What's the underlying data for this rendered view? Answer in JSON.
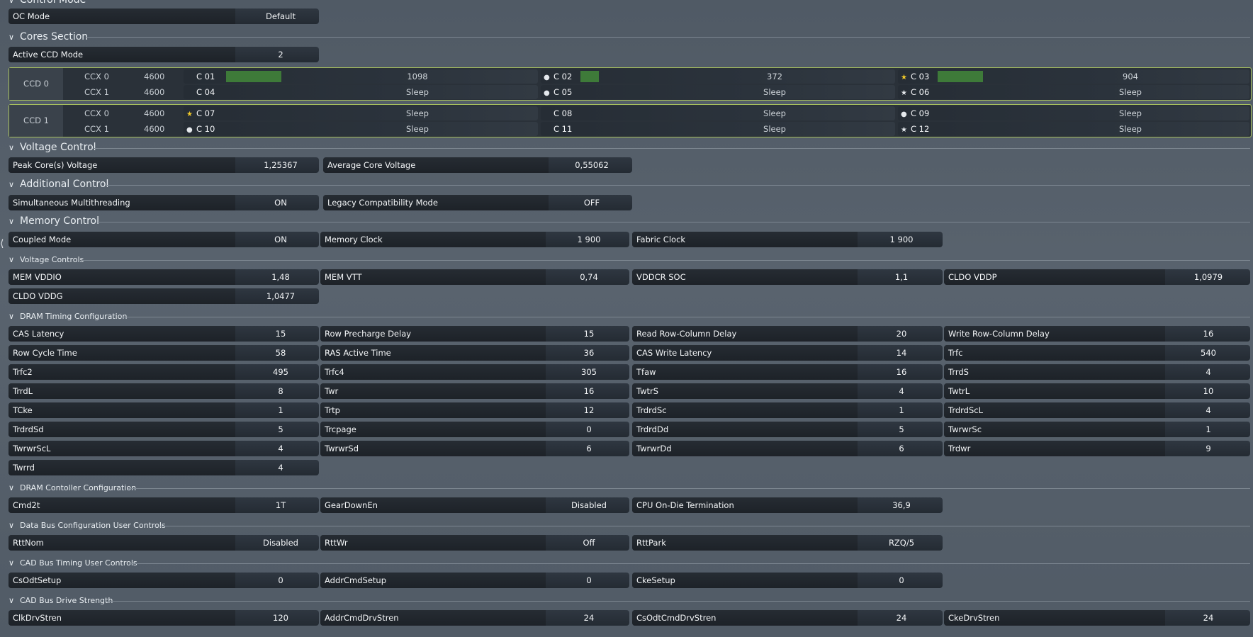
{
  "sections": {
    "control_mode": "Control Mode",
    "cores": "Cores Section",
    "voltage_control": "Voltage Control",
    "additional_control": "Additional Control",
    "memory_control": "Memory Control",
    "voltage_controls": "Voltage Controls",
    "dram_timing": "DRAM Timing Configuration",
    "dram_controller": "DRAM Contoller Configuration",
    "data_bus": "Data Bus Configuration User Controls",
    "cad_bus_timing": "CAD Bus Timing User Controls",
    "cad_bus_drive": "CAD Bus Drive Strength"
  },
  "oc_mode": {
    "label": "OC Mode",
    "value": "Default"
  },
  "active_ccd": {
    "label": "Active CCD Mode",
    "value": "2"
  },
  "ccd0": {
    "label": "CCD 0",
    "ccx0": {
      "label": "CCX 0",
      "freq": "4600"
    },
    "ccx1": {
      "label": "CCX 1",
      "freq": "4600"
    },
    "cores": [
      {
        "name": "C 01",
        "value": "1098",
        "marker": "none",
        "load": 0.15
      },
      {
        "name": "C 02",
        "value": "372",
        "marker": "dot",
        "load": 0.05
      },
      {
        "name": "C 03",
        "value": "904",
        "marker": "star-gold",
        "load": 0.13
      },
      {
        "name": "C 04",
        "value": "Sleep",
        "marker": "none"
      },
      {
        "name": "C 05",
        "value": "Sleep",
        "marker": "dot"
      },
      {
        "name": "C 06",
        "value": "Sleep",
        "marker": "star-white"
      }
    ]
  },
  "ccd1": {
    "label": "CCD 1",
    "ccx0": {
      "label": "CCX 0",
      "freq": "4600"
    },
    "ccx1": {
      "label": "CCX 1",
      "freq": "4600"
    },
    "cores": [
      {
        "name": "C 07",
        "value": "Sleep",
        "marker": "star-gold"
      },
      {
        "name": "C 08",
        "value": "Sleep",
        "marker": "none"
      },
      {
        "name": "C 09",
        "value": "Sleep",
        "marker": "dot"
      },
      {
        "name": "C 10",
        "value": "Sleep",
        "marker": "dot"
      },
      {
        "name": "C 11",
        "value": "Sleep",
        "marker": "none"
      },
      {
        "name": "C 12",
        "value": "Sleep",
        "marker": "star-white"
      }
    ]
  },
  "voltage": {
    "peak": {
      "label": "Peak Core(s) Voltage",
      "value": "1,25367"
    },
    "average": {
      "label": "Average Core Voltage",
      "value": "0,55062"
    }
  },
  "additional": {
    "smt": {
      "label": "Simultaneous Multithreading",
      "value": "ON"
    },
    "legacy": {
      "label": "Legacy Compatibility Mode",
      "value": "OFF"
    }
  },
  "memory": {
    "coupled": {
      "label": "Coupled Mode",
      "value": "ON"
    },
    "mem_clock": {
      "label": "Memory Clock",
      "value": "1 900"
    },
    "fabric_clock": {
      "label": "Fabric Clock",
      "value": "1 900"
    }
  },
  "voltages": {
    "mem_vddio": {
      "label": "MEM VDDIO",
      "value": "1,48"
    },
    "mem_vtt": {
      "label": "MEM VTT",
      "value": "0,74"
    },
    "vddcr_soc": {
      "label": "VDDCR SOC",
      "value": "1,1"
    },
    "cldo_vddp": {
      "label": "CLDO VDDP",
      "value": "1,0979"
    },
    "cldo_vddg": {
      "label": "CLDO VDDG",
      "value": "1,0477"
    }
  },
  "timings": [
    {
      "label": "CAS Latency",
      "value": "15"
    },
    {
      "label": "Row Precharge Delay",
      "value": "15"
    },
    {
      "label": "Read Row-Column Delay",
      "value": "20"
    },
    {
      "label": "Write Row-Column Delay",
      "value": "16"
    },
    {
      "label": "Row Cycle Time",
      "value": "58"
    },
    {
      "label": "RAS Active Time",
      "value": "36"
    },
    {
      "label": "CAS Write Latency",
      "value": "14"
    },
    {
      "label": "Trfc",
      "value": "540"
    },
    {
      "label": "Trfc2",
      "value": "495"
    },
    {
      "label": "Trfc4",
      "value": "305"
    },
    {
      "label": "Tfaw",
      "value": "16"
    },
    {
      "label": "TrrdS",
      "value": "4"
    },
    {
      "label": "TrrdL",
      "value": "8"
    },
    {
      "label": "Twr",
      "value": "16"
    },
    {
      "label": "TwtrS",
      "value": "4"
    },
    {
      "label": "TwtrL",
      "value": "10"
    },
    {
      "label": "TCke",
      "value": "1"
    },
    {
      "label": "Trtp",
      "value": "12"
    },
    {
      "label": "TrdrdSc",
      "value": "1"
    },
    {
      "label": "TrdrdScL",
      "value": "4"
    },
    {
      "label": "TrdrdSd",
      "value": "5"
    },
    {
      "label": "Trcpage",
      "value": "0"
    },
    {
      "label": "TrdrdDd",
      "value": "5"
    },
    {
      "label": "TwrwrSc",
      "value": "1"
    },
    {
      "label": "TwrwrScL",
      "value": "4"
    },
    {
      "label": "TwrwrSd",
      "value": "6"
    },
    {
      "label": "TwrwrDd",
      "value": "6"
    },
    {
      "label": "Trdwr",
      "value": "9"
    },
    {
      "label": "Twrrd",
      "value": "4"
    }
  ],
  "controller": {
    "cmd2t": {
      "label": "Cmd2t",
      "value": "1T"
    },
    "geardown": {
      "label": "GearDownEn",
      "value": "Disabled"
    },
    "odt": {
      "label": "CPU On-Die Termination",
      "value": "36,9"
    }
  },
  "databus": {
    "rttnom": {
      "label": "RttNom",
      "value": "Disabled"
    },
    "rttwr": {
      "label": "RttWr",
      "value": "Off"
    },
    "rttpark": {
      "label": "RttPark",
      "value": "RZQ/5"
    }
  },
  "cadtiming": {
    "csodt": {
      "label": "CsOdtSetup",
      "value": "0"
    },
    "addrcmd": {
      "label": "AddrCmdSetup",
      "value": "0"
    },
    "cke": {
      "label": "CkeSetup",
      "value": "0"
    }
  },
  "caddrive": {
    "clk": {
      "label": "ClkDrvStren",
      "value": "120"
    },
    "addrcmd": {
      "label": "AddrCmdDrvStren",
      "value": "24"
    },
    "csodt": {
      "label": "CsOdtCmdDrvStren",
      "value": "24"
    },
    "cke": {
      "label": "CkeDrvStren",
      "value": "24"
    }
  },
  "edge_arrow": "chevron-left-icon"
}
